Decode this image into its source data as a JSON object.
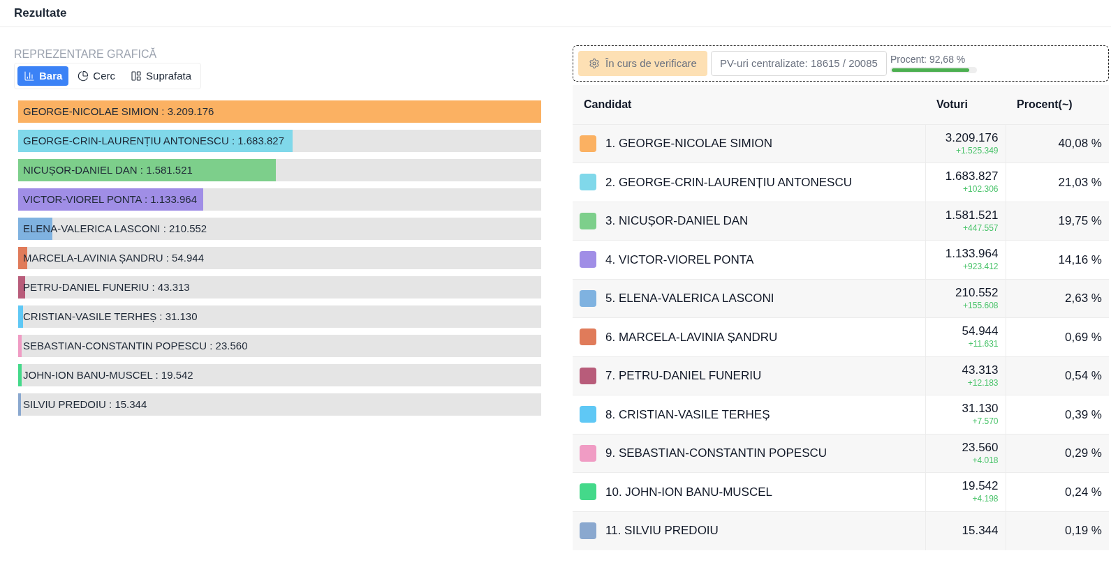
{
  "header": {
    "title": "Rezultate"
  },
  "chart_section": {
    "title": "REPREZENTARE GRAFICĂ",
    "tabs": [
      {
        "label": "Bara",
        "kind": "bar",
        "selected": true
      },
      {
        "label": "Cerc",
        "kind": "pie",
        "selected": false
      },
      {
        "label": "Suprafata",
        "kind": "area",
        "selected": false
      }
    ],
    "bars": [
      {
        "label": "GEORGE-NICOLAE SIMION : 3.209.176",
        "level": 1,
        "color": "#fbb162"
      },
      {
        "label": "GEORGE-CRIN-LAURENȚIU ANTONESCU : 1.683.827",
        "level": 0.5247,
        "color": "#80d8ea"
      },
      {
        "label": "NICUȘOR-DANIEL DAN : 1.581.521",
        "level": 0.4928,
        "color": "#7dcf8b"
      },
      {
        "label": "VICTOR-VIOREL PONTA : 1.133.964",
        "level": 0.3533,
        "color": "#a08ee6"
      },
      {
        "label": "ELENA-VALERICA LASCONI : 210.552",
        "level": 0.0656,
        "color": "#7fb2e0"
      },
      {
        "label": "MARCELA-LAVINIA ȘANDRU : 54.944",
        "level": 0.0171,
        "color": "#e07b5a"
      },
      {
        "label": "PETRU-DANIEL FUNERIU : 43.313",
        "level": 0.0135,
        "color": "#b85c7a"
      },
      {
        "label": "CRISTIAN-VASILE TERHEȘ : 31.130",
        "level": 0.0097,
        "color": "#5fc8f5"
      },
      {
        "label": "SEBASTIAN-CONSTANTIN POPESCU : 23.560",
        "level": 0.0073,
        "color": "#f09cc4"
      },
      {
        "label": "JOHN-ION BANU-MUSCEL : 19.542",
        "level": 0.0061,
        "color": "#44d98a"
      },
      {
        "label": "SILVIU PREDOIU : 15.344",
        "level": 0.0048,
        "color": "#8aa8cf"
      }
    ]
  },
  "status": {
    "verification": "În curs de verificare",
    "pv": "PV-uri centralizate: 18615 / 20085",
    "progress_label": "Procent: 92,68 %",
    "level": 0.9268
  },
  "table": {
    "columns": [
      "Candidat",
      "Voturi",
      "Procent(~)"
    ],
    "rows": [
      {
        "candidate": "1. GEORGE-NICOLAE SIMION",
        "votes": "3.209.176",
        "delta": "+1.525.349",
        "percent": "40,08 %",
        "color": "#fbb162"
      },
      {
        "candidate": "2. GEORGE-CRIN-LAURENȚIU ANTONESCU",
        "votes": "1.683.827",
        "delta": "+102.306",
        "percent": "21,03 %",
        "color": "#80d8ea"
      },
      {
        "candidate": "3. NICUȘOR-DANIEL DAN",
        "votes": "1.581.521",
        "delta": "+447.557",
        "percent": "19,75 %",
        "color": "#7dcf8b"
      },
      {
        "candidate": "4. VICTOR-VIOREL PONTA",
        "votes": "1.133.964",
        "delta": "+923.412",
        "percent": "14,16 %",
        "color": "#a08ee6"
      },
      {
        "candidate": "5. ELENA-VALERICA LASCONI",
        "votes": "210.552",
        "delta": "+155.608",
        "percent": "2,63 %",
        "color": "#7fb2e0"
      },
      {
        "candidate": "6. MARCELA-LAVINIA ȘANDRU",
        "votes": "54.944",
        "delta": "+11.631",
        "percent": "0,69 %",
        "color": "#e07b5a"
      },
      {
        "candidate": "7. PETRU-DANIEL FUNERIU",
        "votes": "43.313",
        "delta": "+12.183",
        "percent": "0,54 %",
        "color": "#b85c7a"
      },
      {
        "candidate": "8. CRISTIAN-VASILE TERHEȘ",
        "votes": "31.130",
        "delta": "+7.570",
        "percent": "0,39 %",
        "color": "#5fc8f5"
      },
      {
        "candidate": "9. SEBASTIAN-CONSTANTIN POPESCU",
        "votes": "23.560",
        "delta": "+4.018",
        "percent": "0,29 %",
        "color": "#f09cc4"
      },
      {
        "candidate": "10. JOHN-ION BANU-MUSCEL",
        "votes": "19.542",
        "delta": "+4.198",
        "percent": "0,24 %",
        "color": "#44d98a"
      },
      {
        "candidate": "11. SILVIU PREDOIU",
        "votes": "15.344",
        "percent": "0,19 %",
        "color": "#8aa8cf"
      }
    ]
  }
}
